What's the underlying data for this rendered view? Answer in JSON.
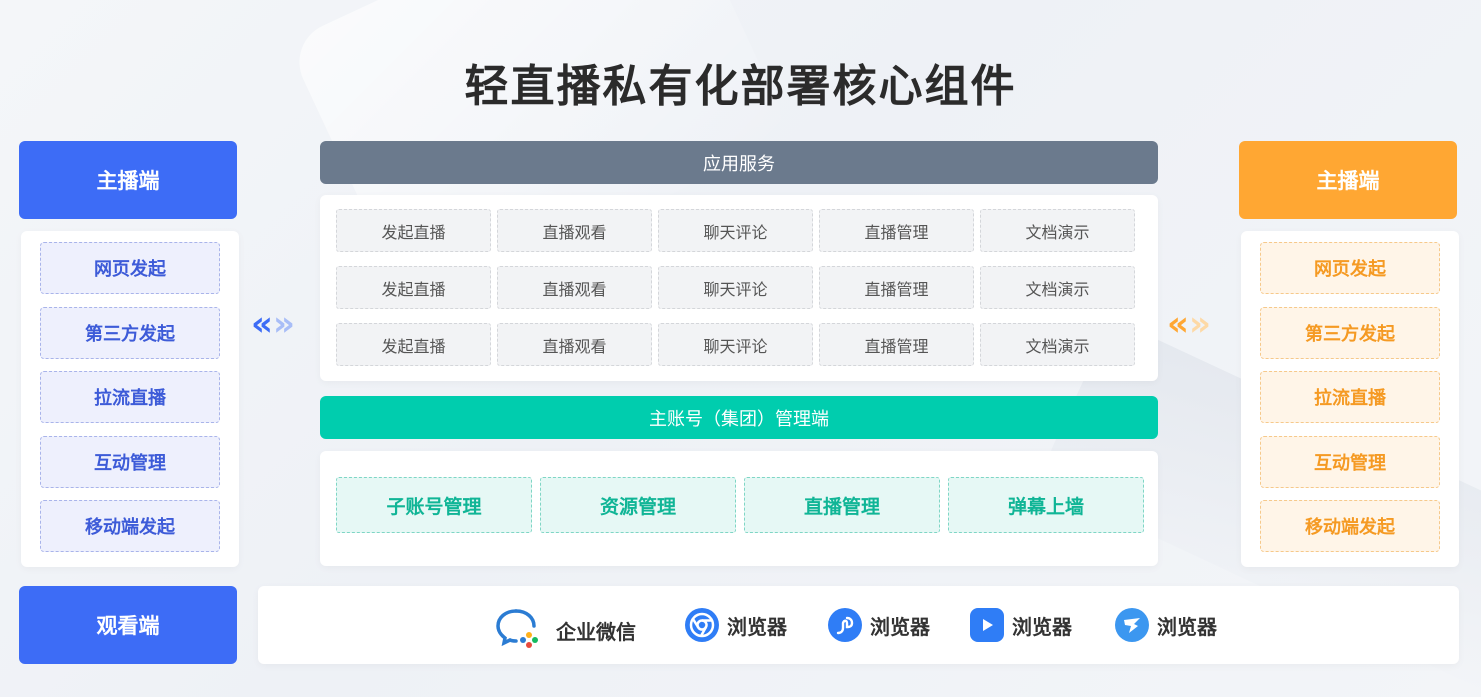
{
  "title": "轻直播私有化部署核心组件",
  "left": {
    "header": "主播端",
    "items": [
      "网页发起",
      "第三方发起",
      "拉流直播",
      "互动管理",
      "移动端发起"
    ]
  },
  "right": {
    "header": "主播端",
    "items": [
      "网页发起",
      "第三方发起",
      "拉流直播",
      "互动管理",
      "移动端发起"
    ]
  },
  "center": {
    "service_bar": "应用服务",
    "services": [
      [
        "发起直播",
        "直播观看",
        "聊天评论",
        "直播管理",
        "文档演示"
      ],
      [
        "发起直播",
        "直播观看",
        "聊天评论",
        "直播管理",
        "文档演示"
      ],
      [
        "发起直播",
        "直播观看",
        "聊天评论",
        "直播管理",
        "文档演示"
      ]
    ],
    "mgmt_bar": "主账号（集团）管理端",
    "mgmt_items": [
      "子账号管理",
      "资源管理",
      "直播管理",
      "弹幕上墙"
    ]
  },
  "viewer": {
    "header": "观看端",
    "clients": [
      {
        "label": "企业微信",
        "icon": "wecom-icon"
      },
      {
        "label": "浏览器",
        "icon": "chrome-browser-icon"
      },
      {
        "label": "浏览器",
        "icon": "link-browser-icon"
      },
      {
        "label": "浏览器",
        "icon": "play-browser-icon"
      },
      {
        "label": "浏览器",
        "icon": "bird-browser-icon"
      }
    ]
  },
  "colors": {
    "blue": "#3d6cf6",
    "orange": "#ffa733",
    "gray_bar": "#6b7a8d",
    "teal": "#00cdae"
  }
}
